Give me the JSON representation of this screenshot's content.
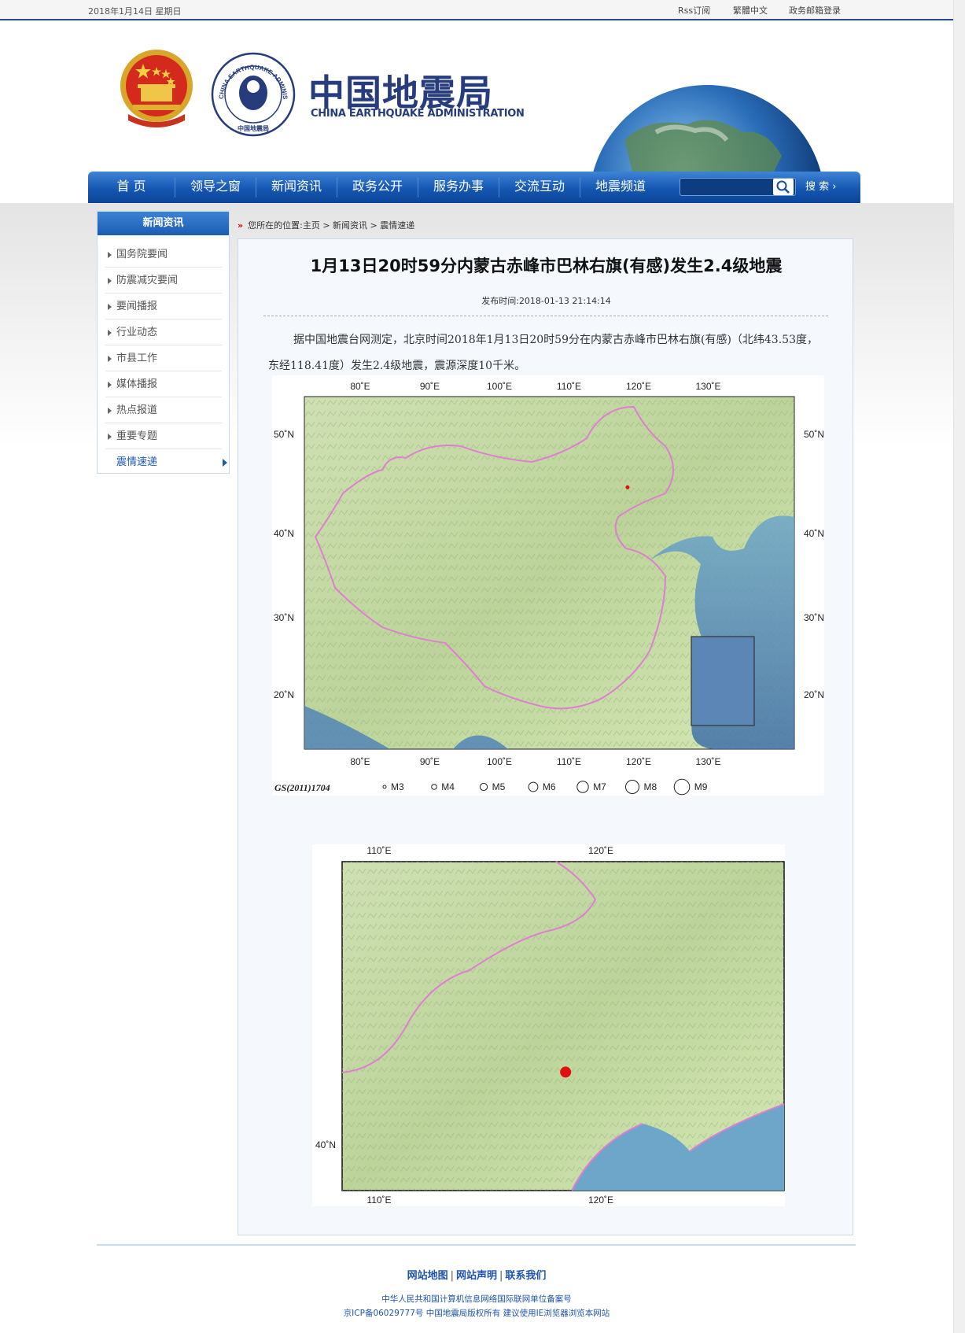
{
  "topbar": {
    "date": "2018年1月14日 星期日",
    "links": [
      "Rss订阅",
      "繁體中文",
      "政务邮箱登录"
    ]
  },
  "header": {
    "title_cn": "中国地震局",
    "title_en": "CHINA EARTHQUAKE ADMINISTRATION",
    "seal_text": "CHINA EARTHQUAKE ADMINISTRATION",
    "seal_cn": "中国地震局"
  },
  "nav": {
    "items": [
      "首 页",
      "领导之窗",
      "新闻资讯",
      "政务公开",
      "服务办事",
      "交流互动",
      "地震频道"
    ],
    "search_label": "搜 索 ›",
    "search_placeholder": ""
  },
  "sidebar": {
    "heading": "新闻资讯",
    "items": [
      "国务院要闻",
      "防震减灾要闻",
      "要闻播报",
      "行业动态",
      "市县工作",
      "媒体播报",
      "热点报道",
      "重要专题",
      "震情速递"
    ],
    "active": "震情速递"
  },
  "breadcrumb": {
    "prefix": "您所在的位置:",
    "path": "主页 > 新闻资讯 > 震情速递"
  },
  "article": {
    "title": "1月13日20时59分内蒙古赤峰市巴林右旗(有感)发生2.4级地震",
    "pub_label": "发布时间:",
    "pub_time": "2018-01-13 21:14:14",
    "body": "据中国地震台网测定，北京时间2018年1月13日20时59分在内蒙古赤峰市巴林右旗(有感)（北纬43.53度，东经118.41度）发生2.4级地震，震源深度10千米。"
  },
  "map1": {
    "lon_ticks": [
      "80˚E",
      "90˚E",
      "100˚E",
      "110˚E",
      "120˚E",
      "130˚E"
    ],
    "lat_ticks": [
      "50˚N",
      "40˚N",
      "30˚N",
      "20˚N"
    ],
    "gs_label": "GS(2011)1704",
    "legend": [
      "M3",
      "M4",
      "M5",
      "M6",
      "M7",
      "M8",
      "M9"
    ],
    "epicenter_lon": 118.41,
    "epicenter_lat": 43.53
  },
  "map2": {
    "lon_ticks": [
      "110˚E",
      "120˚E"
    ],
    "lat_ticks": [
      "40˚N"
    ],
    "epicenter_lon": 118.41,
    "epicenter_lat": 43.53
  },
  "footer": {
    "links": [
      "网站地图",
      "网站声明",
      "联系我们"
    ],
    "line1": "中华人民共和国计算机信息网络国际联网单位备案号",
    "line2": "京ICP备06029777号 中国地震局版权所有 建议使用IE浏览器浏览本网站"
  }
}
